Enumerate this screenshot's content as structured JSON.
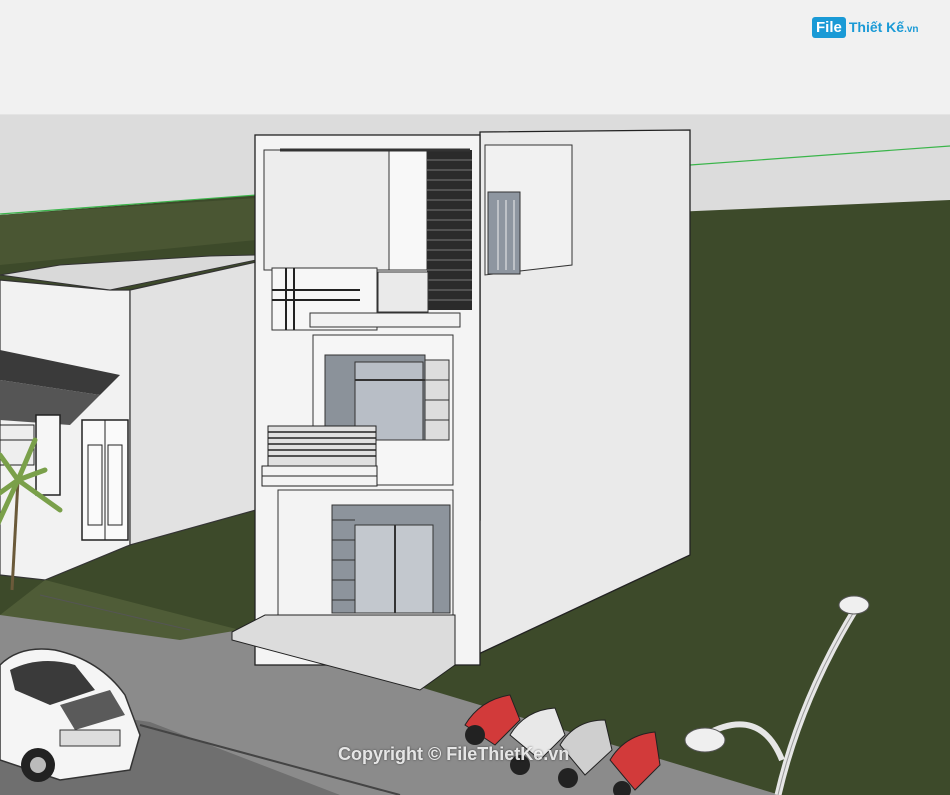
{
  "logo": {
    "file": "File",
    "brand": "Thiết Kế",
    "domain": ".vn"
  },
  "watermark": {
    "text": "Copyright © FileThietKe.vn"
  },
  "colors": {
    "sky": "#ececec",
    "grass": "#3f4a2c",
    "horizon": "#3ab54a",
    "pavement": "#8a8a8a",
    "wall": "#eeeeee",
    "brand": "#1a9ad6"
  }
}
